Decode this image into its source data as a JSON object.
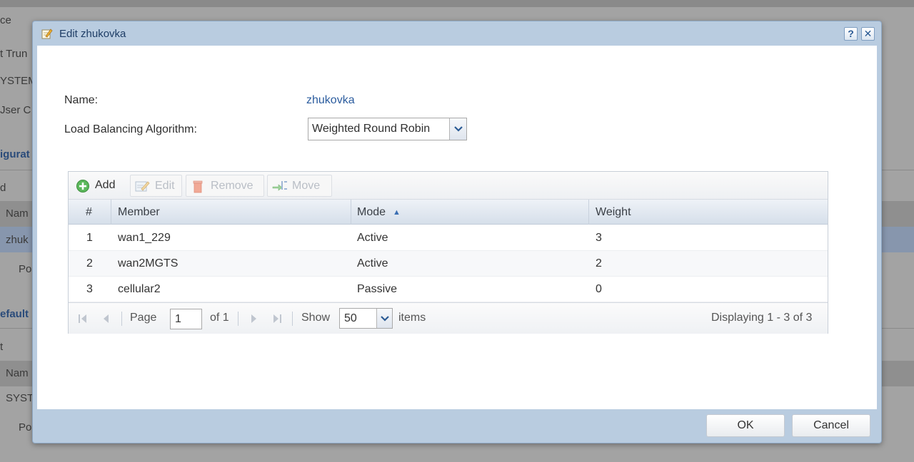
{
  "background": {
    "labels": [
      "ce",
      "t Trun",
      "YSTEM",
      "Jser C",
      "d",
      "Nam",
      "zhuk",
      "Po",
      "t",
      "Nam",
      "SYST",
      "Po"
    ],
    "sections": [
      "igurat",
      "efault"
    ]
  },
  "dialog": {
    "title": "Edit zhukovka",
    "help_label": "?",
    "close_label": "✕",
    "name_label": "Name:",
    "name_value": "zhukovka",
    "algorithm_label": "Load Balancing Algorithm:",
    "algorithm_value": "Weighted Round Robin",
    "ok_label": "OK",
    "cancel_label": "Cancel"
  },
  "toolbar": {
    "add_label": "Add",
    "edit_label": "Edit",
    "remove_label": "Remove",
    "move_label": "Move"
  },
  "table": {
    "columns": [
      "#",
      "Member",
      "Mode",
      "Weight"
    ],
    "sort_indicator": "▲",
    "rows": [
      {
        "num": "1",
        "member": "wan1_229",
        "mode": "Active",
        "weight": "3"
      },
      {
        "num": "2",
        "member": "wan2MGTS",
        "mode": "Active",
        "weight": "2"
      },
      {
        "num": "3",
        "member": "cellular2",
        "mode": "Passive",
        "weight": "0"
      }
    ]
  },
  "pager": {
    "page_label": "Page",
    "page_value": "1",
    "of_label": "of 1",
    "show_label": "Show",
    "show_value": "50",
    "items_label": "items",
    "displaying": "Displaying 1 - 3 of 3"
  },
  "colors": {
    "dialog_frame": "#b9cce0",
    "accent": "#2b5c9e",
    "header_bg": "#d6dfea"
  },
  "icons": [
    "edit-note-icon",
    "help-icon",
    "close-icon",
    "add-icon",
    "edit-icon",
    "remove-icon",
    "move-icon",
    "chevron-down-icon",
    "first-page-icon",
    "prev-page-icon",
    "next-page-icon",
    "last-page-icon"
  ]
}
